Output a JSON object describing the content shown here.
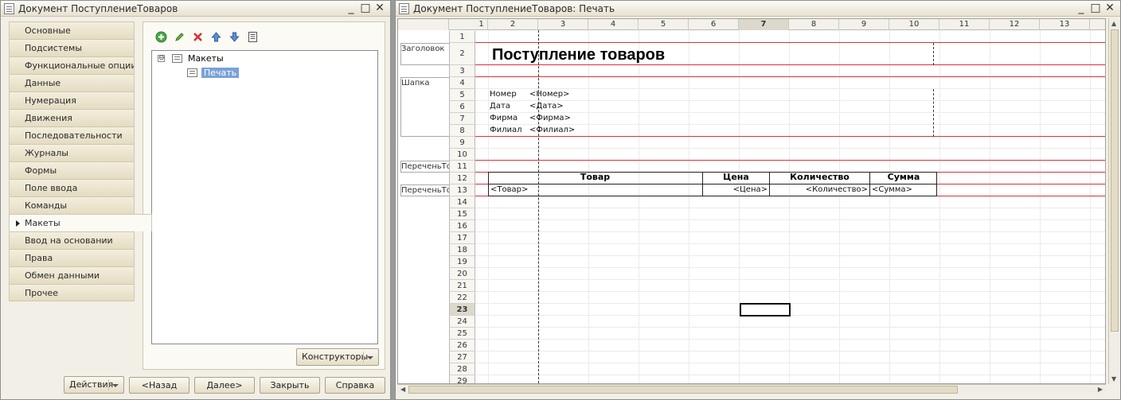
{
  "left_window": {
    "title": "Документ ПоступлениеТоваров",
    "controls": [
      "_",
      "□",
      "✕"
    ],
    "tabs": [
      {
        "label": "Основные"
      },
      {
        "label": "Подсистемы"
      },
      {
        "label": "Функциональные опции"
      },
      {
        "label": "Данные"
      },
      {
        "label": "Нумерация"
      },
      {
        "label": "Движения"
      },
      {
        "label": "Последовательности"
      },
      {
        "label": "Журналы"
      },
      {
        "label": "Формы"
      },
      {
        "label": "Поле ввода"
      },
      {
        "label": "Команды"
      },
      {
        "label": "Макеты",
        "active": true
      },
      {
        "label": "Ввод на основании"
      },
      {
        "label": "Права"
      },
      {
        "label": "Обмен данными"
      },
      {
        "label": "Прочее"
      }
    ],
    "toolbar_icons": [
      "add-icon",
      "edit-icon",
      "delete-icon",
      "move-up-icon",
      "move-down-icon",
      "list-icon"
    ],
    "tree": {
      "root": "Макеты",
      "root_toggle": "⊖",
      "child": "Печать"
    },
    "constructors_button": "Конструкторы",
    "buttons": {
      "actions": "Действия",
      "back": "<Назад",
      "next": "Далее>",
      "close": "Закрыть",
      "help": "Справка"
    }
  },
  "right_window": {
    "title": "Документ ПоступлениеТоваров: Печать",
    "controls": [
      "_",
      "□",
      "✕"
    ],
    "columns": [
      "1",
      "2",
      "3",
      "4",
      "5",
      "6",
      "7",
      "8",
      "9",
      "10",
      "11",
      "12",
      "13"
    ],
    "active_column": "7",
    "rows": [
      "1",
      "2",
      "3",
      "4",
      "5",
      "6",
      "7",
      "8",
      "9",
      "10",
      "11",
      "12",
      "13",
      "14",
      "15",
      "16",
      "17",
      "18",
      "19",
      "20",
      "21",
      "22",
      "23",
      "24",
      "25",
      "26",
      "27",
      "28",
      "29"
    ],
    "active_row": "23",
    "groups": {
      "header": "Заголовок",
      "cap": "Шапка",
      "list_header": "ПереченьТоваровШапка",
      "list_row": "ПереченьТоваровСтрока"
    },
    "title_text": "Поступление товаров",
    "fields": {
      "number_label": "Номер",
      "number_value": "<Номер>",
      "date_label": "Дата",
      "date_value": "<Дата>",
      "firm_label": "Фирма",
      "firm_value": "<Фирма>",
      "branch_label": "Филиал",
      "branch_value": "<Филиал>"
    },
    "table": {
      "headers": [
        "Товар",
        "Цена",
        "Количество",
        "Сумма"
      ],
      "row": [
        "<Товар>",
        "<Цена>",
        "<Количество>",
        "<Сумма>"
      ]
    }
  }
}
